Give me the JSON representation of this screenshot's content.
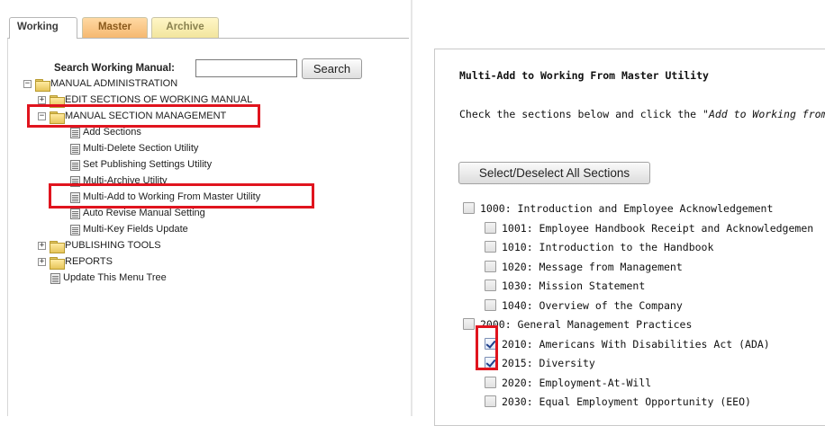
{
  "tabs": [
    {
      "label": "Working",
      "active": true
    },
    {
      "label": "Master",
      "active": false
    },
    {
      "label": "Archive",
      "active": false
    }
  ],
  "search": {
    "label": "Search Working Manual:",
    "value": "",
    "button_label": "Search"
  },
  "tree": {
    "root": {
      "label": "MANUAL ADMINISTRATION",
      "toggle": "−"
    },
    "edit_sections": {
      "label": "EDIT SECTIONS OF WORKING MANUAL",
      "toggle": "+"
    },
    "section_mgmt": {
      "label": "MANUAL SECTION MANAGEMENT",
      "toggle": "−",
      "children": [
        "Add Sections",
        "Multi-Delete Section Utility",
        "Set Publishing Settings Utility",
        "Multi-Archive Utility",
        "Multi-Add to Working From Master Utility",
        "Auto Revise Manual Setting",
        "Multi-Key Fields Update"
      ]
    },
    "publishing_tools": {
      "label": "PUBLISHING TOOLS",
      "toggle": "+"
    },
    "reports": {
      "label": "REPORTS",
      "toggle": "+"
    },
    "update_tree": {
      "label": "Update This Menu Tree"
    }
  },
  "main": {
    "title": "Multi-Add to Working From Master Utility",
    "instruction_prefix": "Check the sections below and click the ",
    "instruction_em": "\"Add to Working from Ma",
    "select_all_label": "Select/Deselect All Sections",
    "sections": [
      {
        "label": "1000: Introduction and Employee Acknowledgement",
        "level": 0,
        "checked": false
      },
      {
        "label": "1001: Employee Handbook Receipt and Acknowledgemen",
        "level": 1,
        "checked": false
      },
      {
        "label": "1010: Introduction to the Handbook",
        "level": 1,
        "checked": false
      },
      {
        "label": "1020: Message from Management",
        "level": 1,
        "checked": false
      },
      {
        "label": "1030: Mission Statement",
        "level": 1,
        "checked": false
      },
      {
        "label": "1040: Overview of the Company",
        "level": 1,
        "checked": false
      },
      {
        "label": "2000: General Management Practices",
        "level": 0,
        "checked": false
      },
      {
        "label": "2010: Americans With Disabilities Act (ADA)",
        "level": 1,
        "checked": true
      },
      {
        "label": "2015: Diversity",
        "level": 1,
        "checked": true
      },
      {
        "label": "2020: Employment-At-Will",
        "level": 1,
        "checked": false
      },
      {
        "label": "2030: Equal Employment Opportunity (EEO)",
        "level": 1,
        "checked": false
      }
    ]
  },
  "colors": {
    "highlight": "#e0141e",
    "master_tab": "#f5b870",
    "archive_tab": "#f2e59d"
  }
}
